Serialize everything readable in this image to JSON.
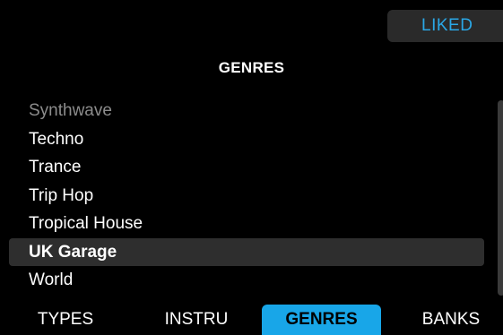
{
  "header": {
    "liked_label": "LIKED",
    "title": "GENRES"
  },
  "genres": {
    "items": [
      {
        "label": "Synthwave",
        "state": "dim"
      },
      {
        "label": "Techno",
        "state": "normal"
      },
      {
        "label": "Trance",
        "state": "normal"
      },
      {
        "label": "Trip Hop",
        "state": "normal"
      },
      {
        "label": "Tropical House",
        "state": "normal"
      },
      {
        "label": "UK Garage",
        "state": "selected"
      },
      {
        "label": "World",
        "state": "normal"
      }
    ]
  },
  "tabs": [
    {
      "label": "TYPES",
      "active": false
    },
    {
      "label": "INSTRU",
      "active": false
    },
    {
      "label": "GENRES",
      "active": true
    },
    {
      "label": "BANKS",
      "active": false
    }
  ],
  "colors": {
    "background": "#000000",
    "accent": "#18a6e8",
    "liked_text": "#2aa7e6",
    "selected_row": "#2e2e2e",
    "dim_text": "#8c8c8c"
  }
}
